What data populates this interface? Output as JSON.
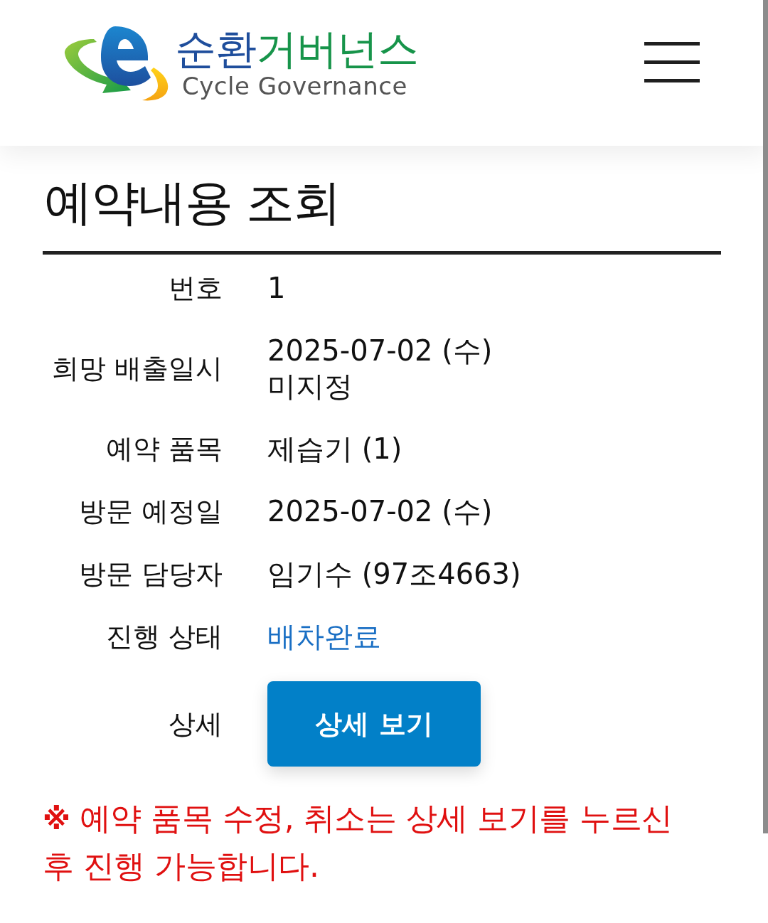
{
  "header": {
    "logo": {
      "title_parts": [
        {
          "text": "순환",
          "color": "#1f4e9c"
        },
        {
          "text": "거버넌스",
          "color": "#17944a"
        }
      ],
      "subtitle": "Cycle Governance"
    }
  },
  "page_title": "예약내용 조회",
  "details": [
    {
      "label": "번호",
      "kind": "text",
      "lines": [
        "1"
      ]
    },
    {
      "label": "희망 배출일시",
      "kind": "text",
      "lines": [
        "2025-07-02 (수)",
        "미지정"
      ]
    },
    {
      "label": "예약 품목",
      "kind": "text",
      "lines": [
        "제습기 (1)"
      ]
    },
    {
      "label": "방문 예정일",
      "kind": "text",
      "lines": [
        "2025-07-02 (수)"
      ]
    },
    {
      "label": "방문 담당자",
      "kind": "text",
      "lines": [
        "임기수 (97조4663)"
      ]
    },
    {
      "label": "진행 상태",
      "kind": "status",
      "lines": [
        "배차완료"
      ]
    },
    {
      "label": "상세",
      "kind": "button",
      "lines": [
        "상세 보기"
      ]
    }
  ],
  "notice": "**※** 예약 품목 수정, 취소는 상세 보기를 누르신 후 진행 가능합니다."
}
